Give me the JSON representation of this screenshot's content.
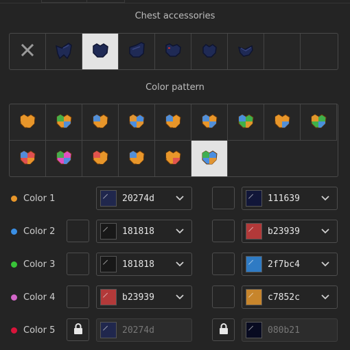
{
  "sections": {
    "chest_title": "Chest accessories",
    "pattern_title": "Color pattern"
  },
  "chest_options": [
    {
      "icon": "none-x-icon"
    },
    {
      "icon": "wrap-icon"
    },
    {
      "icon": "round-chest-icon",
      "selected": true
    },
    {
      "icon": "chest-plate-icon"
    },
    {
      "icon": "chest-dot-icon"
    },
    {
      "icon": "heart-chest-icon"
    },
    {
      "icon": "scarf-icon"
    },
    {
      "icon": "empty-slot"
    }
  ],
  "patterns": [
    {
      "c1": "#e8962a",
      "c2": "#e8962a",
      "c3": "#e8962a"
    },
    {
      "c1": "#e8962a",
      "c2": "#3fb04a",
      "c3": "#4a8ee0"
    },
    {
      "c1": "#e8962a",
      "c2": "#4a8ee0",
      "c3": "#e8962a"
    },
    {
      "c1": "#4a8ee0",
      "c2": "#e8962a",
      "c3": "#e8962a"
    },
    {
      "c1": "#e8962a",
      "c2": "#4a8ee0",
      "c3": "#e8962a"
    },
    {
      "c1": "#e8962a",
      "c2": "#4a8ee0",
      "c3": "#4a8ee0"
    },
    {
      "c1": "#3fb04a",
      "c2": "#4a8ee0",
      "c3": "#e8962a"
    },
    {
      "c1": "#e8962a",
      "c2": "#e8962a",
      "c3": "#4a8ee0"
    },
    {
      "c1": "#3fb04a",
      "c2": "#e8962a",
      "c3": "#4a8ee0"
    },
    {
      "c1": "#e05050",
      "c2": "#4a8ee0",
      "c3": "#e8962a"
    },
    {
      "c1": "#e050c0",
      "c2": "#3fb04a",
      "c3": "#4a8ee0"
    },
    {
      "c1": "#e8962a",
      "c2": "#e05050",
      "c3": "#e8962a"
    },
    {
      "c1": "#e8962a",
      "c2": "#4a8ee0",
      "c3": "#e8962a"
    },
    {
      "c1": "#e8962a",
      "c2": "#e8962a",
      "c3": "#e05050"
    },
    {
      "c1": "#4a8ee0",
      "c2": "#3fb04a",
      "c3": "#e8962a",
      "selected": true
    }
  ],
  "colors": [
    {
      "label": "Color 1",
      "dot": "#e8962a",
      "locked": false,
      "left_check": false,
      "primary": {
        "hex": "20274d",
        "swatch": "#20274d"
      },
      "secondary": {
        "hex": "111639",
        "swatch": "#111639"
      }
    },
    {
      "label": "Color 2",
      "dot": "#3a8fe5",
      "locked": false,
      "left_check": true,
      "primary": {
        "hex": "181818",
        "swatch": "#181818"
      },
      "secondary": {
        "hex": "b23939",
        "swatch": "#b23939"
      }
    },
    {
      "label": "Color 3",
      "dot": "#38c438",
      "locked": false,
      "left_check": true,
      "primary": {
        "hex": "181818",
        "swatch": "#181818"
      },
      "secondary": {
        "hex": "2f7bc4",
        "swatch": "#2f7bc4"
      }
    },
    {
      "label": "Color 4",
      "dot": "#d266c8",
      "locked": false,
      "left_check": true,
      "primary": {
        "hex": "b23939",
        "swatch": "#b23939"
      },
      "secondary": {
        "hex": "c7852c",
        "swatch": "#c7852c"
      }
    },
    {
      "label": "Color 5",
      "dot": "#d9143a",
      "locked": true,
      "left_check": true,
      "primary": {
        "hex": "20274d",
        "swatch": "#20274d"
      },
      "secondary": {
        "hex": "080b21",
        "swatch": "#080b21"
      }
    }
  ]
}
